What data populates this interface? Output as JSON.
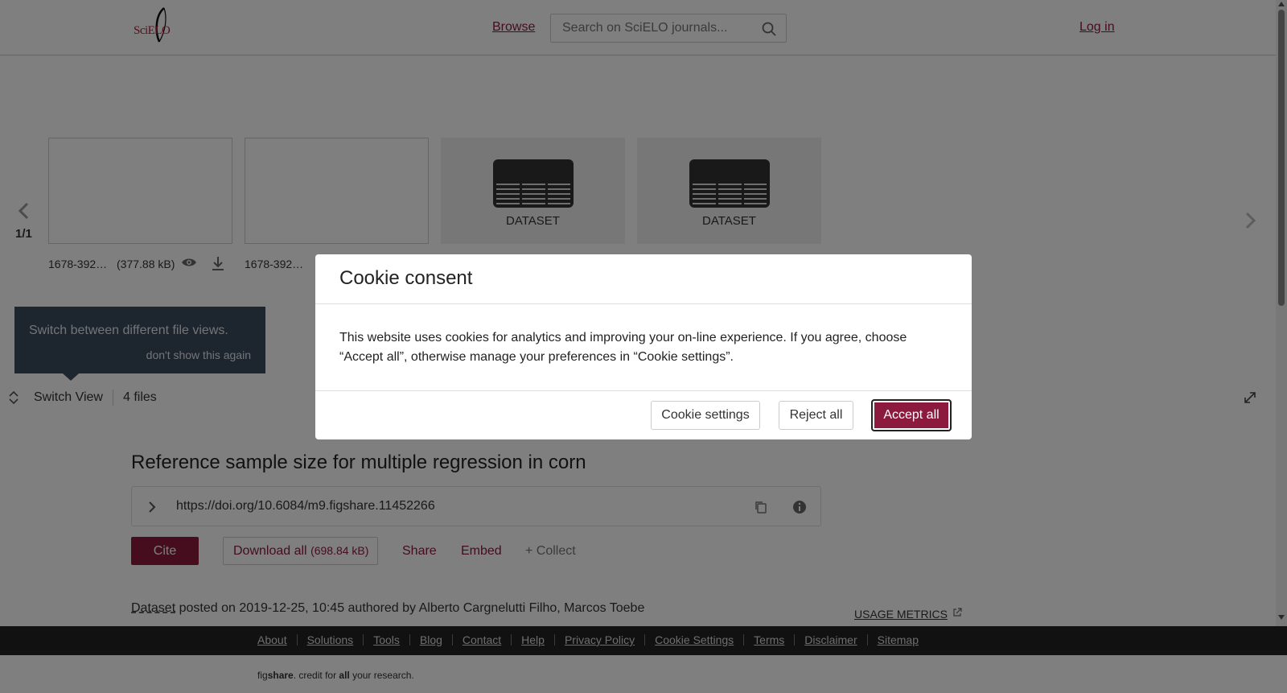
{
  "header": {
    "logo_alt": "SciELO",
    "browse_label": "Browse",
    "search_placeholder": "Search on SciELO journals...",
    "login_label": "Log in"
  },
  "gallery": {
    "page_counter": "1/1",
    "files": [
      {
        "name": "1678-392…",
        "size": "(377.88 kB)",
        "type": "image"
      },
      {
        "name": "1678-392…",
        "size": "",
        "type": "image"
      },
      {
        "name": "",
        "size": "",
        "type": "dataset",
        "label": "DATASET"
      },
      {
        "name": "",
        "size": "",
        "type": "dataset",
        "label": "DATASET"
      }
    ],
    "tooltip": {
      "message": "Switch between different file views.",
      "dismiss": "don't show this again"
    },
    "switch_view_label": "Switch View",
    "files_count": "4 files"
  },
  "item": {
    "title": "Reference sample size for multiple regression in corn",
    "doi": "https://doi.org/10.6084/m9.figshare.11452266",
    "cite_label": "Cite",
    "download_label": "Download all",
    "download_size": "(698.84 kB)",
    "share_label": "Share",
    "embed_label": "Embed",
    "collect_label": "+ Collect",
    "posted": {
      "type_label": "Dataset",
      "text": " posted on 2019-12-25, 10:45 authored by Alberto Cargnelutti Filho, Marcos Toebe"
    },
    "usage_metrics_label": "USAGE METRICS"
  },
  "footer": {
    "links": [
      "About",
      "Solutions",
      "Tools",
      "Blog",
      "Contact",
      "Help",
      "Privacy Policy",
      "Cookie Settings",
      "Terms",
      "Disclaimer",
      "Sitemap"
    ],
    "credit_fig": "fig",
    "credit_share": "share",
    "credit_mid": ". credit for ",
    "credit_all": "all",
    "credit_end": " your research."
  },
  "cookie_modal": {
    "title": "Cookie consent",
    "body": "This website uses cookies for analytics and improving your on-line experience. If you agree, choose “Accept all”, otherwise manage your preferences in “Cookie settings”.",
    "settings_label": "Cookie settings",
    "reject_label": "Reject all",
    "accept_label": "Accept all"
  },
  "colors": {
    "brand": "#8c1a3f",
    "tooltip_bg": "#3a4a5e",
    "footer_bg": "#222222"
  }
}
